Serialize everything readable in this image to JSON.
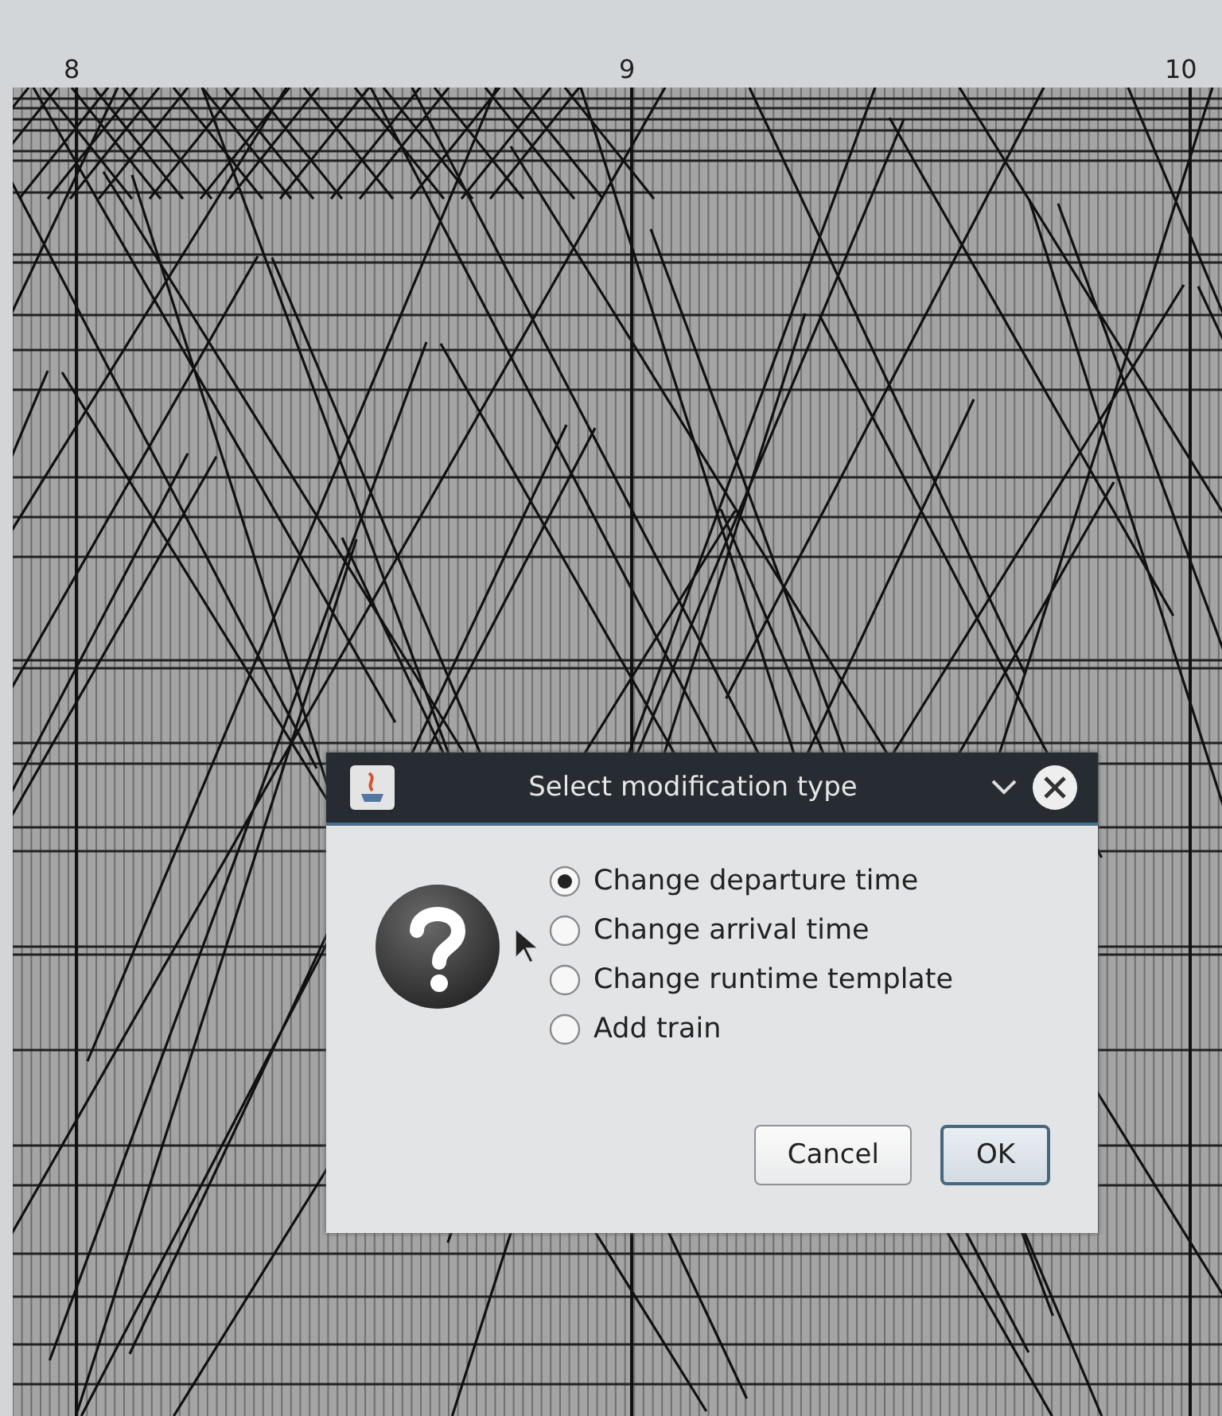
{
  "time_axis": {
    "hour_labels": [
      "8",
      "9",
      "10"
    ]
  },
  "dialog": {
    "title": "Select modification type",
    "options": [
      {
        "label": "Change departure time",
        "selected": true
      },
      {
        "label": "Change arrival time",
        "selected": false
      },
      {
        "label": "Change runtime template",
        "selected": false
      },
      {
        "label": "Add train",
        "selected": false
      }
    ],
    "buttons": [
      {
        "label": "Cancel",
        "kind": "normal"
      },
      {
        "label": "OK",
        "kind": "default"
      }
    ]
  }
}
